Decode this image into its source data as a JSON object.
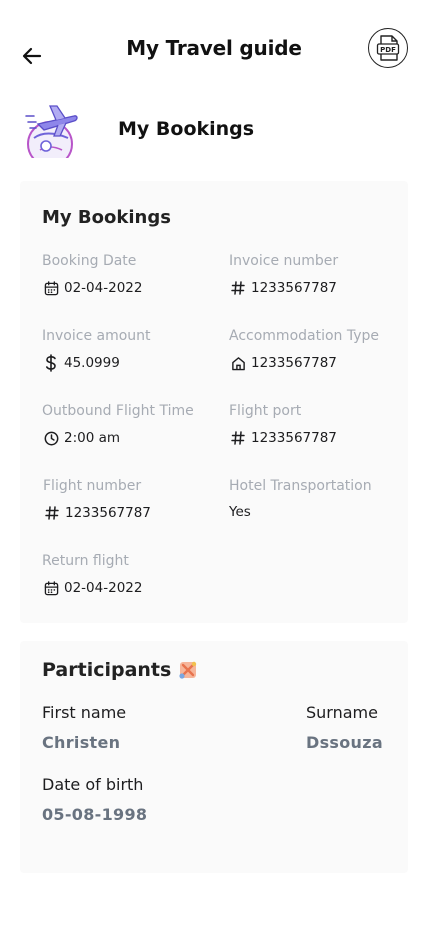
{
  "header": {
    "title": "My Travel guide",
    "back_icon": "arrow-left-icon",
    "pdf_icon": "pdf-icon",
    "pdf_label": "PDF"
  },
  "hero": {
    "title": "My Bookings",
    "illustration": "airplane-globe-icon"
  },
  "bookings": {
    "title": "My Bookings",
    "fields": [
      {
        "label": "Booking Date",
        "value": "02-04-2022",
        "icon": "calendar-icon"
      },
      {
        "label": "Invoice number",
        "value": "1233567787",
        "icon": "hash-icon"
      },
      {
        "label": "Invoice amount",
        "value": "45.0999",
        "icon": "dollar-icon"
      },
      {
        "label": "Accommodation Type",
        "value": "1233567787",
        "icon": "home-icon"
      },
      {
        "label": "Outbound Flight Time",
        "value": "2:00 am",
        "icon": "clock-icon"
      },
      {
        "label": "Flight port",
        "value": "1233567787",
        "icon": "hash-icon"
      },
      {
        "label": "Flight number",
        "value": "1233567787",
        "icon": "hash-icon"
      },
      {
        "label": "Hotel Transportation",
        "value": "Yes",
        "icon": ""
      },
      {
        "label": "Return flight",
        "value": "02-04-2022",
        "icon": "calendar-icon"
      }
    ]
  },
  "participants": {
    "title": "Participants",
    "badge_icon": "participants-badge-icon",
    "first_name_label": "First name",
    "first_name": "Christen",
    "surname_label": "Surname",
    "surname": "Dssouza",
    "dob_label": "Date of birth",
    "dob": "05-08-1998"
  },
  "colors": {
    "label_gray": "#a6abb3",
    "value_slate": "#697380",
    "card_bg": "#fafafa"
  }
}
